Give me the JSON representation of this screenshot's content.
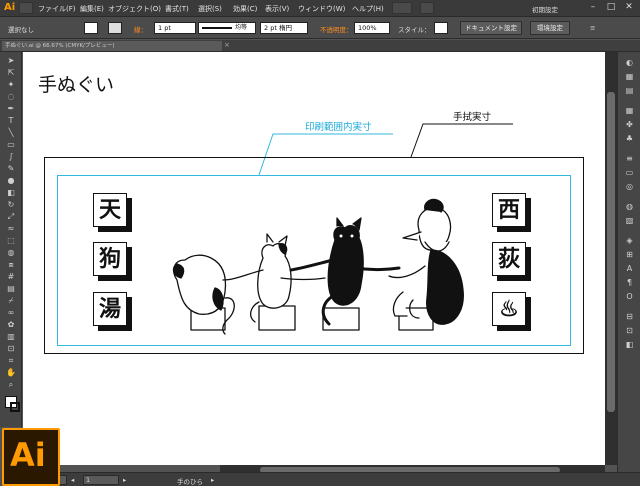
{
  "app": {
    "logo_text": "Ai",
    "accent": "#ff9a00",
    "workspace_label": "初期設定"
  },
  "menu": [
    "ファイル(F)",
    "編集(E)",
    "オブジェクト(O)",
    "書式(T)",
    "選択(S)",
    "効果(C)",
    "表示(V)",
    "ウィンドウ(W)",
    "ヘルプ(H)"
  ],
  "control_bar": {
    "selection": "選択なし",
    "stroke_label": "線：",
    "stroke_weight": "1 pt",
    "stroke_style": "均等",
    "brush": "2 pt 楕円",
    "opacity_label": "不透明度：",
    "opacity": "100%",
    "style_label": "スタイル：",
    "doc_settings": "ドキュメント設定",
    "prefs": "環境設定"
  },
  "doc_tab": {
    "title": "手ぬぐい.ai @ 66.67% (CMYK/プレビュー)"
  },
  "artboard": {
    "title": "手ぬぐい",
    "print_label": "印刷範囲内実寸",
    "cloth_label": "手拭実寸",
    "print_color": "#33b8e0",
    "left_kanji": [
      "天",
      "狗",
      "湯"
    ],
    "right_kanji": [
      "西",
      "荻",
      "♨"
    ]
  },
  "status": {
    "zoom": "66.67%",
    "page": "1",
    "tool": "手のひら"
  }
}
